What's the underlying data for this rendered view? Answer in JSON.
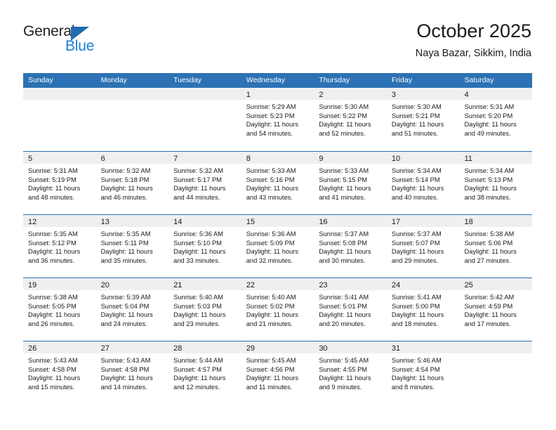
{
  "brand": {
    "name_part1": "General",
    "name_part2": "Blue",
    "triangle_color": "#1f6cb0",
    "blue_text_color": "#1b7fd4"
  },
  "header": {
    "title": "October 2025",
    "subtitle": "Naya Bazar, Sikkim, India"
  },
  "theme": {
    "header_blue": "#2c72b4",
    "daynum_band": "#efefef",
    "text": "#1a1a1a"
  },
  "weekdays": [
    "Sunday",
    "Monday",
    "Tuesday",
    "Wednesday",
    "Thursday",
    "Friday",
    "Saturday"
  ],
  "weeks": [
    [
      {
        "day": "",
        "sunrise": "",
        "sunset": "",
        "daylight_l1": "",
        "daylight_l2": ""
      },
      {
        "day": "",
        "sunrise": "",
        "sunset": "",
        "daylight_l1": "",
        "daylight_l2": ""
      },
      {
        "day": "",
        "sunrise": "",
        "sunset": "",
        "daylight_l1": "",
        "daylight_l2": ""
      },
      {
        "day": "1",
        "sunrise": "Sunrise: 5:29 AM",
        "sunset": "Sunset: 5:23 PM",
        "daylight_l1": "Daylight: 11 hours",
        "daylight_l2": "and 54 minutes."
      },
      {
        "day": "2",
        "sunrise": "Sunrise: 5:30 AM",
        "sunset": "Sunset: 5:22 PM",
        "daylight_l1": "Daylight: 11 hours",
        "daylight_l2": "and 52 minutes."
      },
      {
        "day": "3",
        "sunrise": "Sunrise: 5:30 AM",
        "sunset": "Sunset: 5:21 PM",
        "daylight_l1": "Daylight: 11 hours",
        "daylight_l2": "and 51 minutes."
      },
      {
        "day": "4",
        "sunrise": "Sunrise: 5:31 AM",
        "sunset": "Sunset: 5:20 PM",
        "daylight_l1": "Daylight: 11 hours",
        "daylight_l2": "and 49 minutes."
      }
    ],
    [
      {
        "day": "5",
        "sunrise": "Sunrise: 5:31 AM",
        "sunset": "Sunset: 5:19 PM",
        "daylight_l1": "Daylight: 11 hours",
        "daylight_l2": "and 48 minutes."
      },
      {
        "day": "6",
        "sunrise": "Sunrise: 5:32 AM",
        "sunset": "Sunset: 5:18 PM",
        "daylight_l1": "Daylight: 11 hours",
        "daylight_l2": "and 46 minutes."
      },
      {
        "day": "7",
        "sunrise": "Sunrise: 5:32 AM",
        "sunset": "Sunset: 5:17 PM",
        "daylight_l1": "Daylight: 11 hours",
        "daylight_l2": "and 44 minutes."
      },
      {
        "day": "8",
        "sunrise": "Sunrise: 5:33 AM",
        "sunset": "Sunset: 5:16 PM",
        "daylight_l1": "Daylight: 11 hours",
        "daylight_l2": "and 43 minutes."
      },
      {
        "day": "9",
        "sunrise": "Sunrise: 5:33 AM",
        "sunset": "Sunset: 5:15 PM",
        "daylight_l1": "Daylight: 11 hours",
        "daylight_l2": "and 41 minutes."
      },
      {
        "day": "10",
        "sunrise": "Sunrise: 5:34 AM",
        "sunset": "Sunset: 5:14 PM",
        "daylight_l1": "Daylight: 11 hours",
        "daylight_l2": "and 40 minutes."
      },
      {
        "day": "11",
        "sunrise": "Sunrise: 5:34 AM",
        "sunset": "Sunset: 5:13 PM",
        "daylight_l1": "Daylight: 11 hours",
        "daylight_l2": "and 38 minutes."
      }
    ],
    [
      {
        "day": "12",
        "sunrise": "Sunrise: 5:35 AM",
        "sunset": "Sunset: 5:12 PM",
        "daylight_l1": "Daylight: 11 hours",
        "daylight_l2": "and 36 minutes."
      },
      {
        "day": "13",
        "sunrise": "Sunrise: 5:35 AM",
        "sunset": "Sunset: 5:11 PM",
        "daylight_l1": "Daylight: 11 hours",
        "daylight_l2": "and 35 minutes."
      },
      {
        "day": "14",
        "sunrise": "Sunrise: 5:36 AM",
        "sunset": "Sunset: 5:10 PM",
        "daylight_l1": "Daylight: 11 hours",
        "daylight_l2": "and 33 minutes."
      },
      {
        "day": "15",
        "sunrise": "Sunrise: 5:36 AM",
        "sunset": "Sunset: 5:09 PM",
        "daylight_l1": "Daylight: 11 hours",
        "daylight_l2": "and 32 minutes."
      },
      {
        "day": "16",
        "sunrise": "Sunrise: 5:37 AM",
        "sunset": "Sunset: 5:08 PM",
        "daylight_l1": "Daylight: 11 hours",
        "daylight_l2": "and 30 minutes."
      },
      {
        "day": "17",
        "sunrise": "Sunrise: 5:37 AM",
        "sunset": "Sunset: 5:07 PM",
        "daylight_l1": "Daylight: 11 hours",
        "daylight_l2": "and 29 minutes."
      },
      {
        "day": "18",
        "sunrise": "Sunrise: 5:38 AM",
        "sunset": "Sunset: 5:06 PM",
        "daylight_l1": "Daylight: 11 hours",
        "daylight_l2": "and 27 minutes."
      }
    ],
    [
      {
        "day": "19",
        "sunrise": "Sunrise: 5:38 AM",
        "sunset": "Sunset: 5:05 PM",
        "daylight_l1": "Daylight: 11 hours",
        "daylight_l2": "and 26 minutes."
      },
      {
        "day": "20",
        "sunrise": "Sunrise: 5:39 AM",
        "sunset": "Sunset: 5:04 PM",
        "daylight_l1": "Daylight: 11 hours",
        "daylight_l2": "and 24 minutes."
      },
      {
        "day": "21",
        "sunrise": "Sunrise: 5:40 AM",
        "sunset": "Sunset: 5:03 PM",
        "daylight_l1": "Daylight: 11 hours",
        "daylight_l2": "and 23 minutes."
      },
      {
        "day": "22",
        "sunrise": "Sunrise: 5:40 AM",
        "sunset": "Sunset: 5:02 PM",
        "daylight_l1": "Daylight: 11 hours",
        "daylight_l2": "and 21 minutes."
      },
      {
        "day": "23",
        "sunrise": "Sunrise: 5:41 AM",
        "sunset": "Sunset: 5:01 PM",
        "daylight_l1": "Daylight: 11 hours",
        "daylight_l2": "and 20 minutes."
      },
      {
        "day": "24",
        "sunrise": "Sunrise: 5:41 AM",
        "sunset": "Sunset: 5:00 PM",
        "daylight_l1": "Daylight: 11 hours",
        "daylight_l2": "and 18 minutes."
      },
      {
        "day": "25",
        "sunrise": "Sunrise: 5:42 AM",
        "sunset": "Sunset: 4:59 PM",
        "daylight_l1": "Daylight: 11 hours",
        "daylight_l2": "and 17 minutes."
      }
    ],
    [
      {
        "day": "26",
        "sunrise": "Sunrise: 5:43 AM",
        "sunset": "Sunset: 4:58 PM",
        "daylight_l1": "Daylight: 11 hours",
        "daylight_l2": "and 15 minutes."
      },
      {
        "day": "27",
        "sunrise": "Sunrise: 5:43 AM",
        "sunset": "Sunset: 4:58 PM",
        "daylight_l1": "Daylight: 11 hours",
        "daylight_l2": "and 14 minutes."
      },
      {
        "day": "28",
        "sunrise": "Sunrise: 5:44 AM",
        "sunset": "Sunset: 4:57 PM",
        "daylight_l1": "Daylight: 11 hours",
        "daylight_l2": "and 12 minutes."
      },
      {
        "day": "29",
        "sunrise": "Sunrise: 5:45 AM",
        "sunset": "Sunset: 4:56 PM",
        "daylight_l1": "Daylight: 11 hours",
        "daylight_l2": "and 11 minutes."
      },
      {
        "day": "30",
        "sunrise": "Sunrise: 5:45 AM",
        "sunset": "Sunset: 4:55 PM",
        "daylight_l1": "Daylight: 11 hours",
        "daylight_l2": "and 9 minutes."
      },
      {
        "day": "31",
        "sunrise": "Sunrise: 5:46 AM",
        "sunset": "Sunset: 4:54 PM",
        "daylight_l1": "Daylight: 11 hours",
        "daylight_l2": "and 8 minutes."
      },
      {
        "day": "",
        "sunrise": "",
        "sunset": "",
        "daylight_l1": "",
        "daylight_l2": ""
      }
    ]
  ]
}
